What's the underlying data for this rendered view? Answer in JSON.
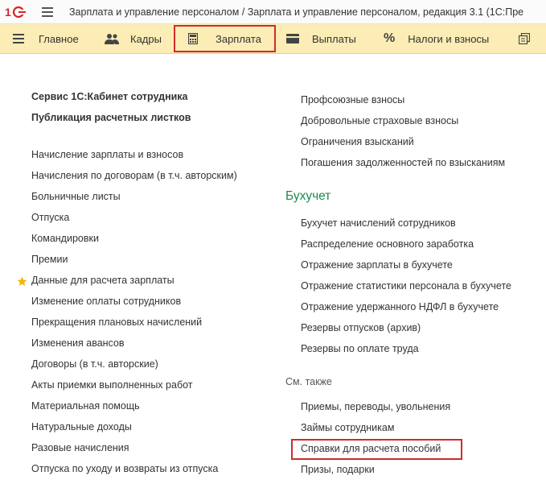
{
  "window": {
    "title": "Зарплата и управление персоналом / Зарплата и управление персоналом, редакция 3.1  (1С:Пре"
  },
  "logo_icon": "1c-logo",
  "colors": {
    "section_bar": "#fbedb5",
    "highlight": "#d12b2b",
    "group_title": "#1f8a4c",
    "star": "#f5b50a"
  },
  "sections": [
    {
      "label": "Главное",
      "icon": "hamburger-icon"
    },
    {
      "label": "Кадры",
      "icon": "people-icon"
    },
    {
      "label": "Зарплата",
      "icon": "calculator-icon",
      "active": true
    },
    {
      "label": "Выплаты",
      "icon": "wallet-icon"
    },
    {
      "label": "Налоги и взносы",
      "icon": "percent-icon"
    },
    {
      "label": "",
      "icon": "documents-icon"
    }
  ],
  "left_column": {
    "service": [
      "Сервис 1С:Кабинет сотрудника",
      "Публикация расчетных листков"
    ],
    "items": [
      "Начисление зарплаты и взносов",
      "Начисления по договорам (в т.ч. авторским)",
      "Больничные листы",
      "Отпуска",
      "Командировки",
      "Премии",
      "Данные для расчета зарплаты",
      "Изменение оплаты сотрудников",
      "Прекращения плановых начислений",
      "Изменения авансов",
      "Договоры (в т.ч. авторские)",
      "Акты приемки выполненных работ",
      "Материальная помощь",
      "Натуральные доходы",
      "Разовые начисления",
      "Отпуска по уходу и возвраты из отпуска"
    ],
    "starred_item": "Данные для расчета зарплаты"
  },
  "right_column": {
    "top_items": [
      "Профсоюзные взносы",
      "Добровольные страховые взносы",
      "Ограничения взысканий",
      "Погашения задолженностей по взысканиям"
    ],
    "accounting": {
      "title": "Бухучет",
      "items": [
        "Бухучет начислений сотрудников",
        "Распределение основного заработка",
        "Отражение зарплаты в бухучете",
        "Отражение статистики персонала в бухучете",
        "Отражение удержанного НДФЛ в бухучете",
        "Резервы отпусков (архив)",
        "Резервы по оплате труда"
      ]
    },
    "see_also": {
      "title": "См. также",
      "items": [
        "Приемы, переводы, увольнения",
        "Займы сотрудникам",
        "Справки для расчета пособий",
        "Призы, подарки"
      ],
      "highlighted_item": "Справки для расчета пособий"
    }
  }
}
